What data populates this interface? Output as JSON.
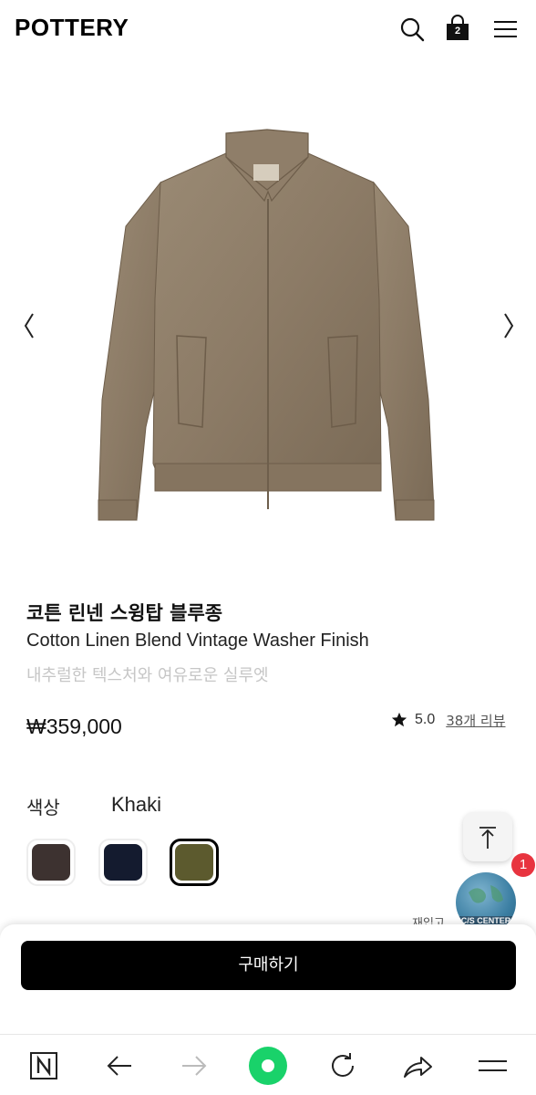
{
  "header": {
    "logo": "POTTERY",
    "cart_count": "2",
    "icons": [
      "search-icon",
      "shopping-bag-icon",
      "hamburger-menu-icon"
    ]
  },
  "product": {
    "name_ko": "코튼 린넨 스윙탑 블루종",
    "name_en": "Cotton Linen Blend Vintage Washer Finish",
    "subtitle": "내추럴한 텍스처와 여유로운 실루엣",
    "price": "₩359,000",
    "rating": "5.0",
    "reviews_link": "38개 리뷰",
    "image_color": "#8c7b66"
  },
  "options": {
    "color_label": "색상",
    "selected_color": "Khaki",
    "swatches": [
      {
        "name": "brown",
        "color": "#3d3230"
      },
      {
        "name": "navy",
        "color": "#141b2f"
      },
      {
        "name": "khaki",
        "color": "#5c5a2e",
        "selected": true
      }
    ]
  },
  "floating": {
    "cs_label": "C/S CENTER",
    "cs_badge": "1",
    "peek_text": "재입고"
  },
  "cta": {
    "buy_label": "구매하기"
  },
  "browser_nav": {
    "icons": [
      "naver-home-icon",
      "back-arrow-icon",
      "forward-arrow-icon",
      "green-dot-icon",
      "refresh-icon",
      "share-icon",
      "menu-icon"
    ],
    "accent": "#19d26a"
  }
}
